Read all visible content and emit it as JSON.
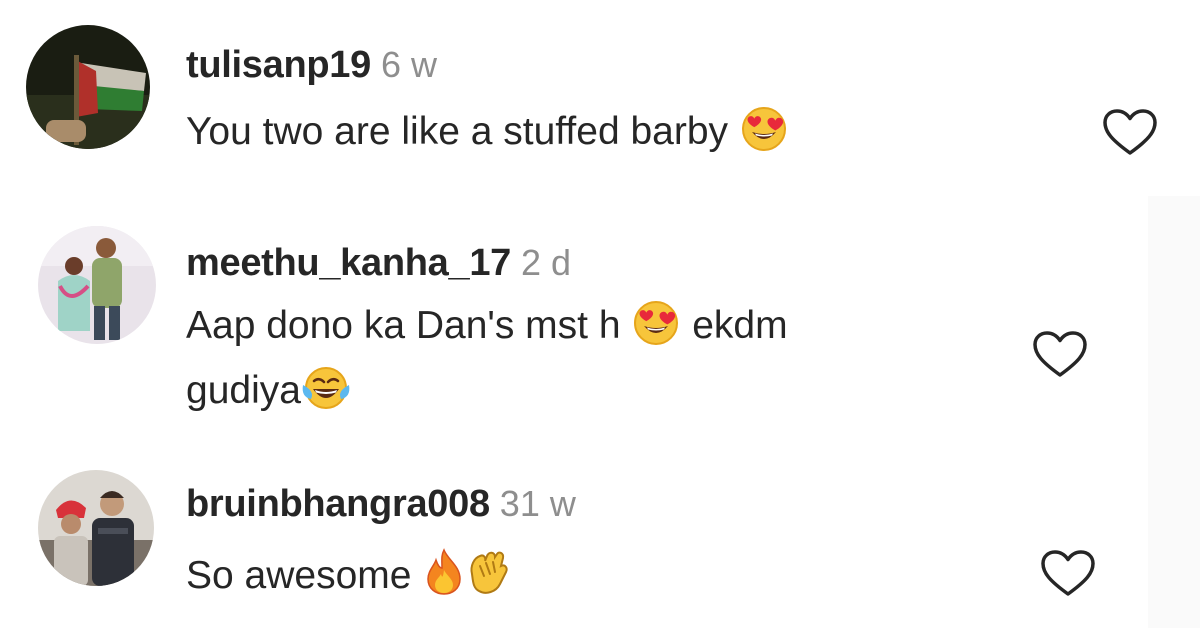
{
  "comments": [
    {
      "username": "tulisanp19",
      "age": "6 w",
      "text_before": "You two are like a stuffed barby",
      "emojis": [
        "heart-eyes"
      ],
      "text_after": ""
    },
    {
      "username": "meethu_kanha_17",
      "age": "2 d",
      "text_line1_before": "Aap dono ka Dan's mst h",
      "text_line1_after": "ekdm",
      "text_line2": "gudiya",
      "emojis": [
        "heart-eyes",
        "tears-of-joy"
      ]
    },
    {
      "username": "bruinbhangra008",
      "age": "31 w",
      "text_before": "So awesome",
      "emojis": [
        "fire",
        "clapping-hands"
      ]
    }
  ],
  "colors": {
    "username": "#262626",
    "age": "#8e8e8e",
    "text": "#262626",
    "heart_outline": "#262626"
  },
  "icons": {
    "like": "heart-outline-icon"
  }
}
